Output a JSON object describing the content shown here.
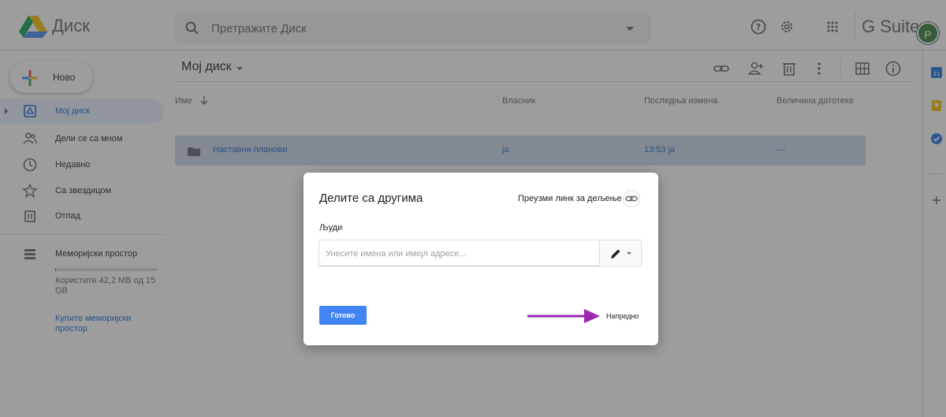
{
  "header": {
    "app_title": "Диск",
    "search_placeholder": "Претражите Диск",
    "icons": [
      "help-icon",
      "settings-icon",
      "apps-grid-icon"
    ],
    "gsuite_label": "G Suite",
    "avatar_letter": "P"
  },
  "sidebar": {
    "new_label": "Ново",
    "items": [
      {
        "label": "Мој диск",
        "icon": "my-drive-icon",
        "active": true
      },
      {
        "label": "Дели се са мном",
        "icon": "shared-icon",
        "active": false
      },
      {
        "label": "Недавно",
        "icon": "clock-icon",
        "active": false
      },
      {
        "label": "Са звездицом",
        "icon": "star-icon",
        "active": false
      },
      {
        "label": "Отпад",
        "icon": "trash-icon",
        "active": false
      },
      {
        "label": "Меморијски простор",
        "icon": "storage-icon",
        "active": false
      }
    ],
    "storage_text": "Користите 42,2 MB од 15 GB",
    "storage_fraction": 0.003,
    "buy_storage": "Купите меморијски простор"
  },
  "main": {
    "breadcrumb": "Мој диск",
    "columns": {
      "name": "Име",
      "owner": "Власник",
      "modified": "Последња измена",
      "size": "Величина датотеке"
    },
    "rows": [
      {
        "name": "Наставни планови",
        "owner": "ја",
        "modified": "13:53 ја",
        "size": "—"
      }
    ]
  },
  "dialog": {
    "title": "Делите са другима",
    "get_link": "Преузми линк за дељење",
    "people_label": "Људи",
    "input_placeholder": "Унесите имена или имејл адресе...",
    "done_label": "Готово",
    "advanced_label": "Напредно"
  },
  "colors": {
    "accent": "#1a73e8",
    "done_button": "#4285f4",
    "arrow": "#9c27b0",
    "selected_row": "#c8d7e8",
    "active_nav": "#e8f0fe"
  }
}
